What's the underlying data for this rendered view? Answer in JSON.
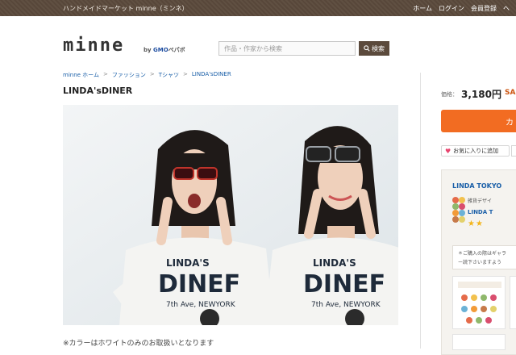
{
  "topbar": {
    "site_name": "ハンドメイドマーケット minne（ミンネ）",
    "links": [
      "ホーム",
      "ログイン",
      "会員登録",
      "ヘ"
    ]
  },
  "header": {
    "logo": "minne",
    "byline_prefix": "by ",
    "byline_brand": "GMO",
    "byline_suffix": "ペパボ",
    "search_placeholder": "作品・作家から検索",
    "search_button": "検索"
  },
  "breadcrumb": {
    "items": [
      "minne ホーム",
      "ファッション",
      "Tシャツ",
      "LINDA'sDINER"
    ],
    "separator": ">"
  },
  "product": {
    "title": "LINDA'sDINER",
    "note": "※カラーはホワイトのみのお取扱いとなります",
    "price_label": "価格：",
    "price": "3,180円",
    "price_suffix": "SALE",
    "cart_button": "カ",
    "favorite_button": "お気に入りに追加",
    "photo_text_left": [
      "LINDA'S",
      "DINEF",
      "7th Ave, NEWYORK"
    ],
    "photo_text_right": [
      "LINDA'S",
      "DINEF",
      "7th Ave, NEWYORK"
    ]
  },
  "shop": {
    "name": "LINDA TOKYO",
    "subtitle": "雑貨デザイ",
    "link": "LINDA T",
    "stars": "★★",
    "notice_line1": "＊ご購入の際はギャラ",
    "notice_line2": "ー読下さいますよう"
  }
}
